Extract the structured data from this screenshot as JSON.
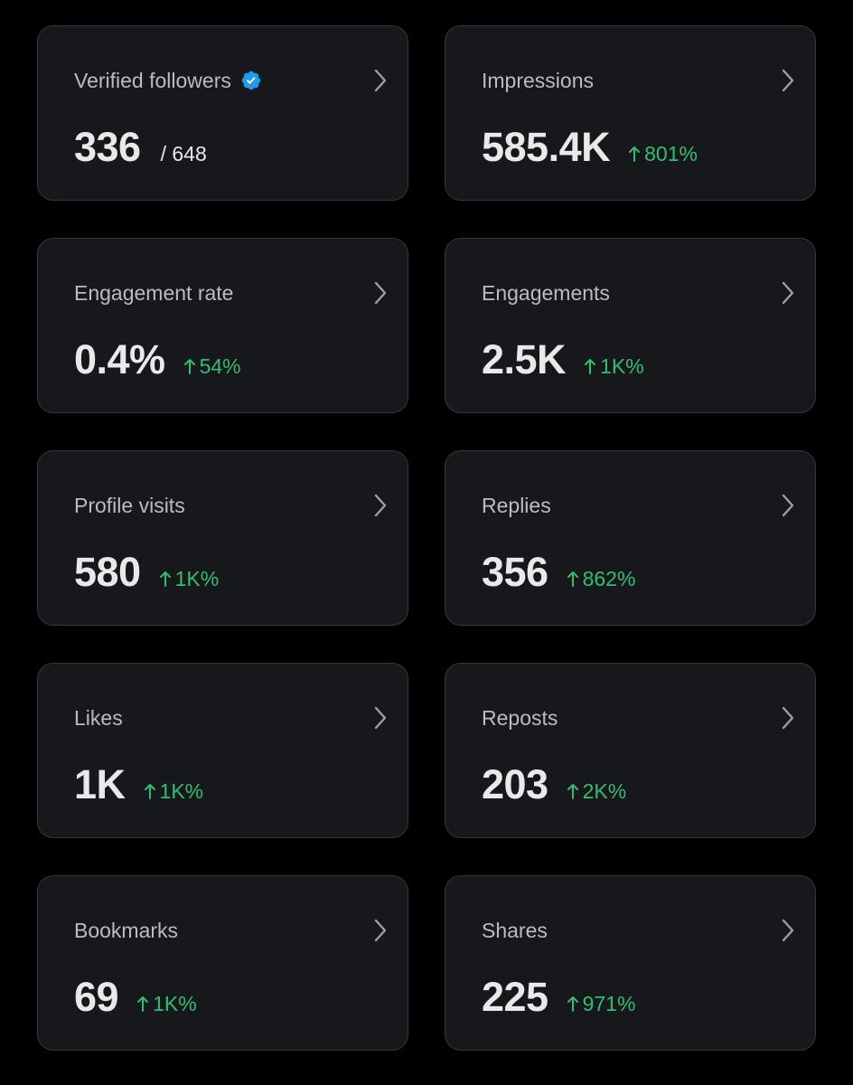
{
  "cards": [
    {
      "title": "Verified followers",
      "value": "336",
      "total": "/ 648",
      "delta": null,
      "verified": true
    },
    {
      "title": "Impressions",
      "value": "585.4K",
      "total": null,
      "delta": "801%",
      "verified": false
    },
    {
      "title": "Engagement rate",
      "value": "0.4%",
      "total": null,
      "delta": "54%",
      "verified": false
    },
    {
      "title": "Engagements",
      "value": "2.5K",
      "total": null,
      "delta": "1K%",
      "verified": false
    },
    {
      "title": "Profile visits",
      "value": "580",
      "total": null,
      "delta": "1K%",
      "verified": false
    },
    {
      "title": "Replies",
      "value": "356",
      "total": null,
      "delta": "862%",
      "verified": false
    },
    {
      "title": "Likes",
      "value": "1K",
      "total": null,
      "delta": "1K%",
      "verified": false
    },
    {
      "title": "Reposts",
      "value": "203",
      "total": null,
      "delta": "2K%",
      "verified": false
    },
    {
      "title": "Bookmarks",
      "value": "69",
      "total": null,
      "delta": "1K%",
      "verified": false
    },
    {
      "title": "Shares",
      "value": "225",
      "total": null,
      "delta": "971%",
      "verified": false
    }
  ],
  "icons": {
    "verified": "verified-badge-icon",
    "chevron": "chevron-right-icon",
    "arrow": "arrow-up-icon"
  },
  "colors": {
    "background": "#000000",
    "card": "#16181c",
    "card_border": "#33363b",
    "title": "#b9bdc2",
    "value": "#e7e9ea",
    "positive": "#2fbf71",
    "verified": "#1d9bf0"
  }
}
